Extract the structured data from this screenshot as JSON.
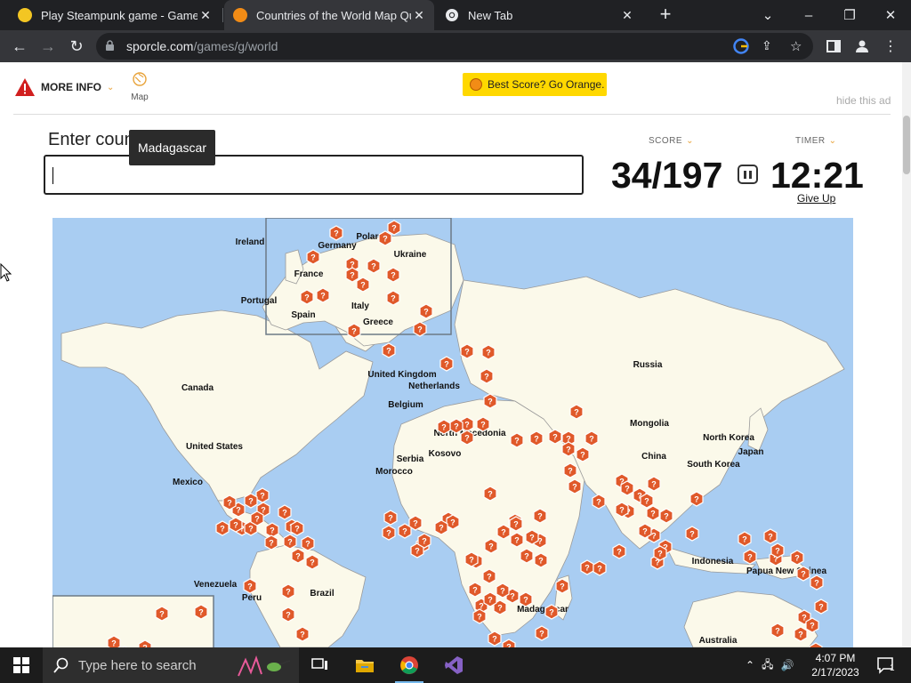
{
  "browser": {
    "tabs": [
      {
        "title": "Play Steampunk game - Gamesfl"
      },
      {
        "title": "Countries of the World Map Quiz"
      },
      {
        "title": "New Tab"
      }
    ],
    "url_host": "sporcle.com",
    "url_path": "/games/g/world"
  },
  "header": {
    "more_info": "MORE INFO",
    "map_label": "Map",
    "best_score": "Best Score? Go Orange.",
    "hide_ad": "hide this ad"
  },
  "quiz": {
    "prompt": "Enter coun",
    "tooltip": "Madagascar",
    "input_value": "",
    "score_label": "SCORE",
    "score": "34/197",
    "timer_label": "TIMER",
    "timer": "12:21",
    "give_up": "Give Up"
  },
  "map": {
    "labels": [
      "Ireland",
      "Germany",
      "Poland",
      "Ukraine",
      "France",
      "Portugal",
      "Spain",
      "Italy",
      "Greece",
      "Russia",
      "Canada",
      "United Kingdom",
      "Netherlands",
      "Belgium",
      "United States",
      "North Macedonia",
      "Kosovo",
      "Serbia",
      "Morocco",
      "Mongolia",
      "North Korea",
      "Japan",
      "South Korea",
      "China",
      "Mexico",
      "Indonesia",
      "Papua New Guinea",
      "Venezuela",
      "Brazil",
      "Peru",
      "Madagascar",
      "Australia"
    ],
    "colors": {
      "water": "#a9cdf2",
      "land": "#fbf9ea",
      "marker": "#e0592a"
    }
  },
  "taskbar": {
    "search_placeholder": "Type here to search",
    "time": "4:07 PM",
    "date": "2/17/2023",
    "notifications": "1"
  }
}
